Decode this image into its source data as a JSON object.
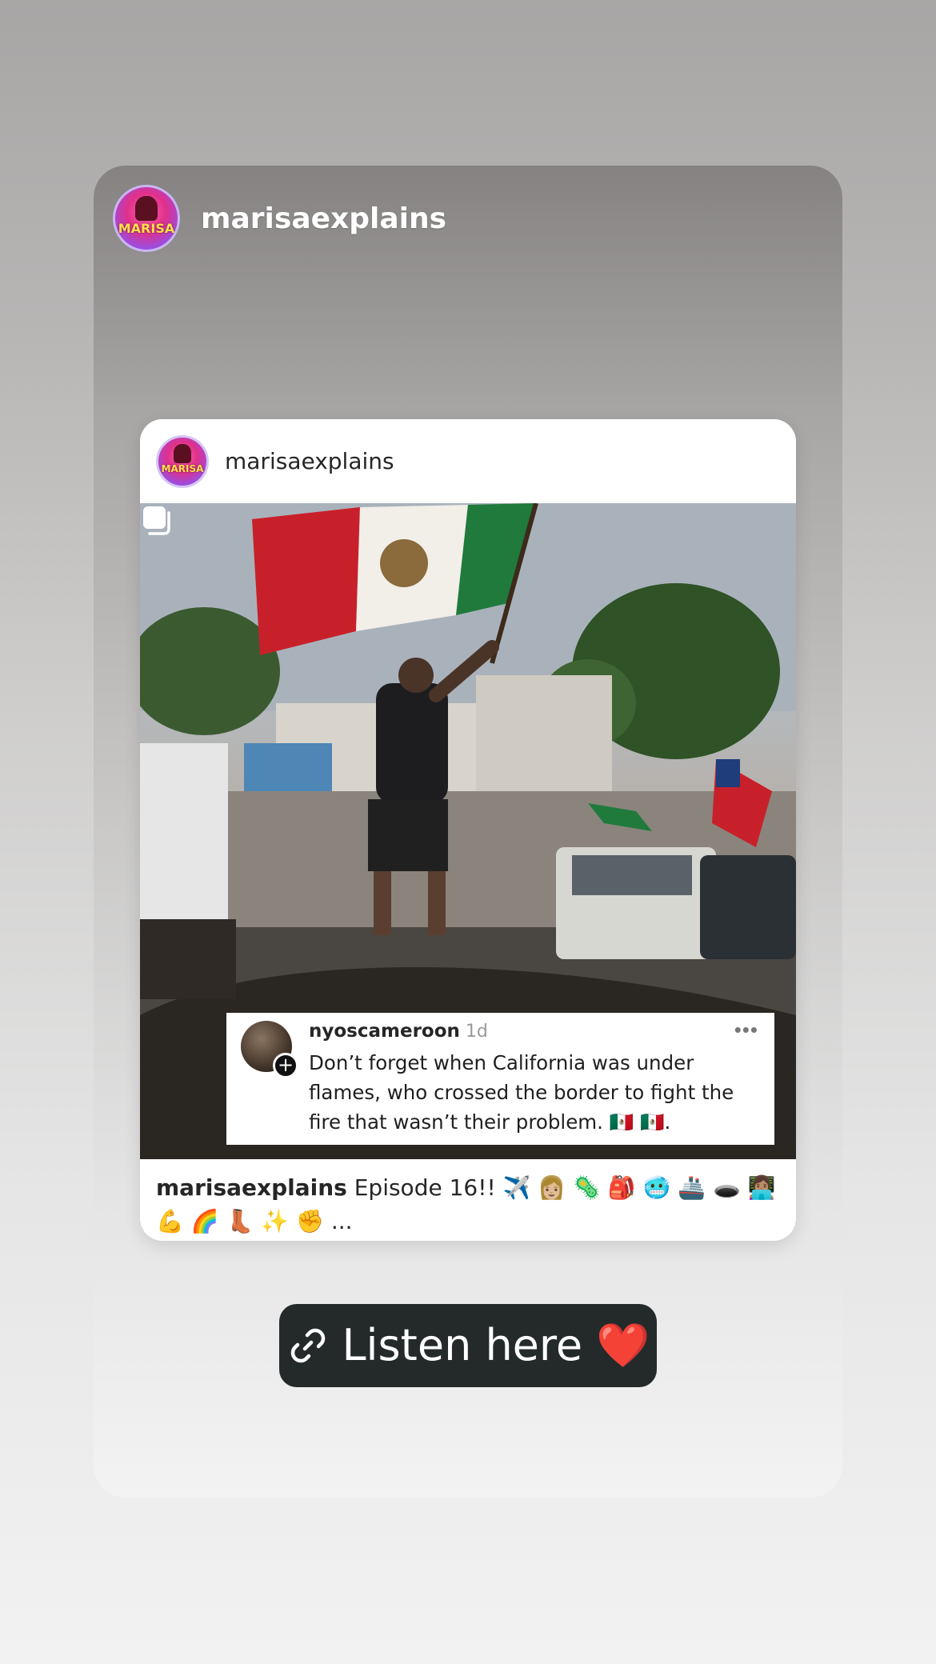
{
  "story": {
    "username": "marisaexplains",
    "avatar_text": "MARISA"
  },
  "post": {
    "username": "marisaexplains",
    "avatar_text": "MARISA",
    "comment": {
      "username": "nyoscameroon",
      "time": "1d",
      "more": "•••",
      "text": "Don’t forget when California was under flames, who crossed the border to fight the fire that wasn’t their problem. 🇲🇽 🇲🇽."
    },
    "caption": {
      "username": "marisaexplains",
      "text": " Episode 16!! ✈️ 👩🏼 🦠 🎒 🥶 🚢 🕳️ 👩🏽‍💻 💪 🌈 👢 ✨ ✊ ..."
    }
  },
  "link_sticker": {
    "label": "Listen here ❤️"
  },
  "colors": {
    "sticker_bg": "#242a2a",
    "card_bg": "#ffffff"
  }
}
